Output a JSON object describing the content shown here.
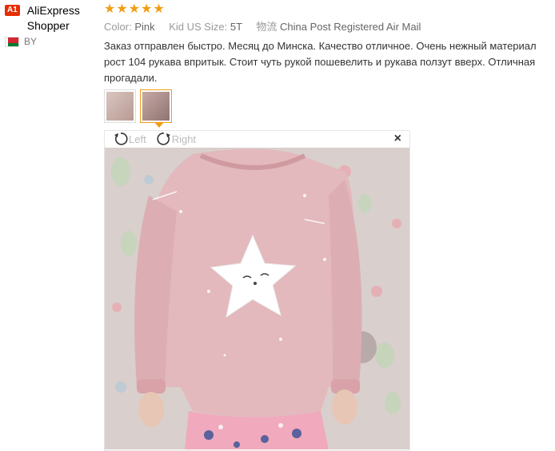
{
  "reviewer": {
    "badge": "A1",
    "name": "AliExpress Shopper",
    "country": "BY"
  },
  "review": {
    "rating": 5,
    "stars": "★★★★★",
    "attributes": [
      {
        "key": "Color:",
        "value": "Pink"
      },
      {
        "key": "Kid US Size:",
        "value": "5T"
      },
      {
        "key": "物流",
        "value": "China Post Registered Air Mail"
      }
    ],
    "text_lines": [
      "Заказ отправлен быстро. Месяц до Минска. Качество отличное. Очень нежный материал",
      "рост 104 рукава впритык. Стоит чуть рукой пошевелить и рукава ползут вверх. Отличная",
      "прогадали."
    ]
  },
  "viewer": {
    "rotate_left_label": "Left",
    "rotate_right_label": "Right",
    "close_label": "×"
  },
  "colors": {
    "star": "#f29c14",
    "badge": "#e62e04",
    "active_thumb_border": "#f29c14"
  }
}
